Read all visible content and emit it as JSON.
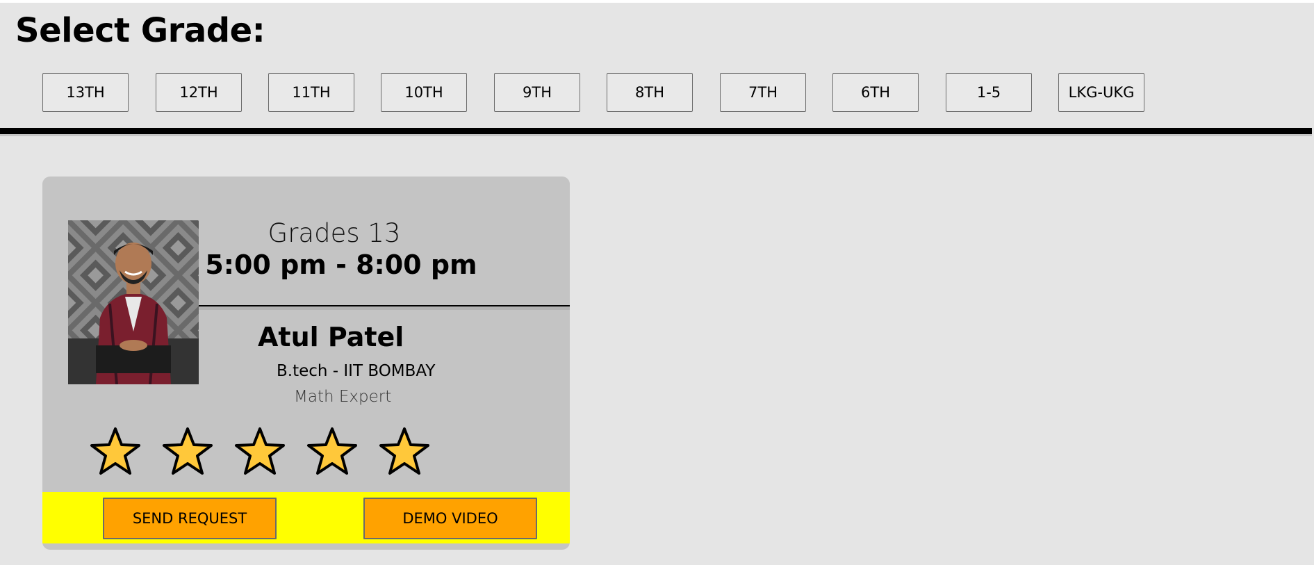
{
  "header": {
    "title": "Select Grade:",
    "grade_buttons": [
      "13TH",
      "12TH",
      "11TH",
      "10TH",
      "9TH",
      "8TH",
      "7TH",
      "6TH",
      "1-5",
      "LKG-UKG"
    ]
  },
  "tutor_card": {
    "grades": "Grades 13",
    "time": "5:00 pm - 8:00 pm",
    "name": "Atul Patel",
    "degree": "B.tech - IIT BOMBAY",
    "subject": "Math Expert",
    "rating": {
      "value": 5,
      "max": 5
    },
    "send_request_label": "SEND REQUEST",
    "demo_video_label": "DEMO VIDEO"
  },
  "colors": {
    "page_background": "#e5e5e5",
    "card_background": "#c4c4c4",
    "action_bar": "#ffff00",
    "action_button": "#ffa200",
    "star_fill": "#ffc83a"
  },
  "icons": {
    "rating_star": "star-icon",
    "tutor_photo": "tutor-photo"
  }
}
